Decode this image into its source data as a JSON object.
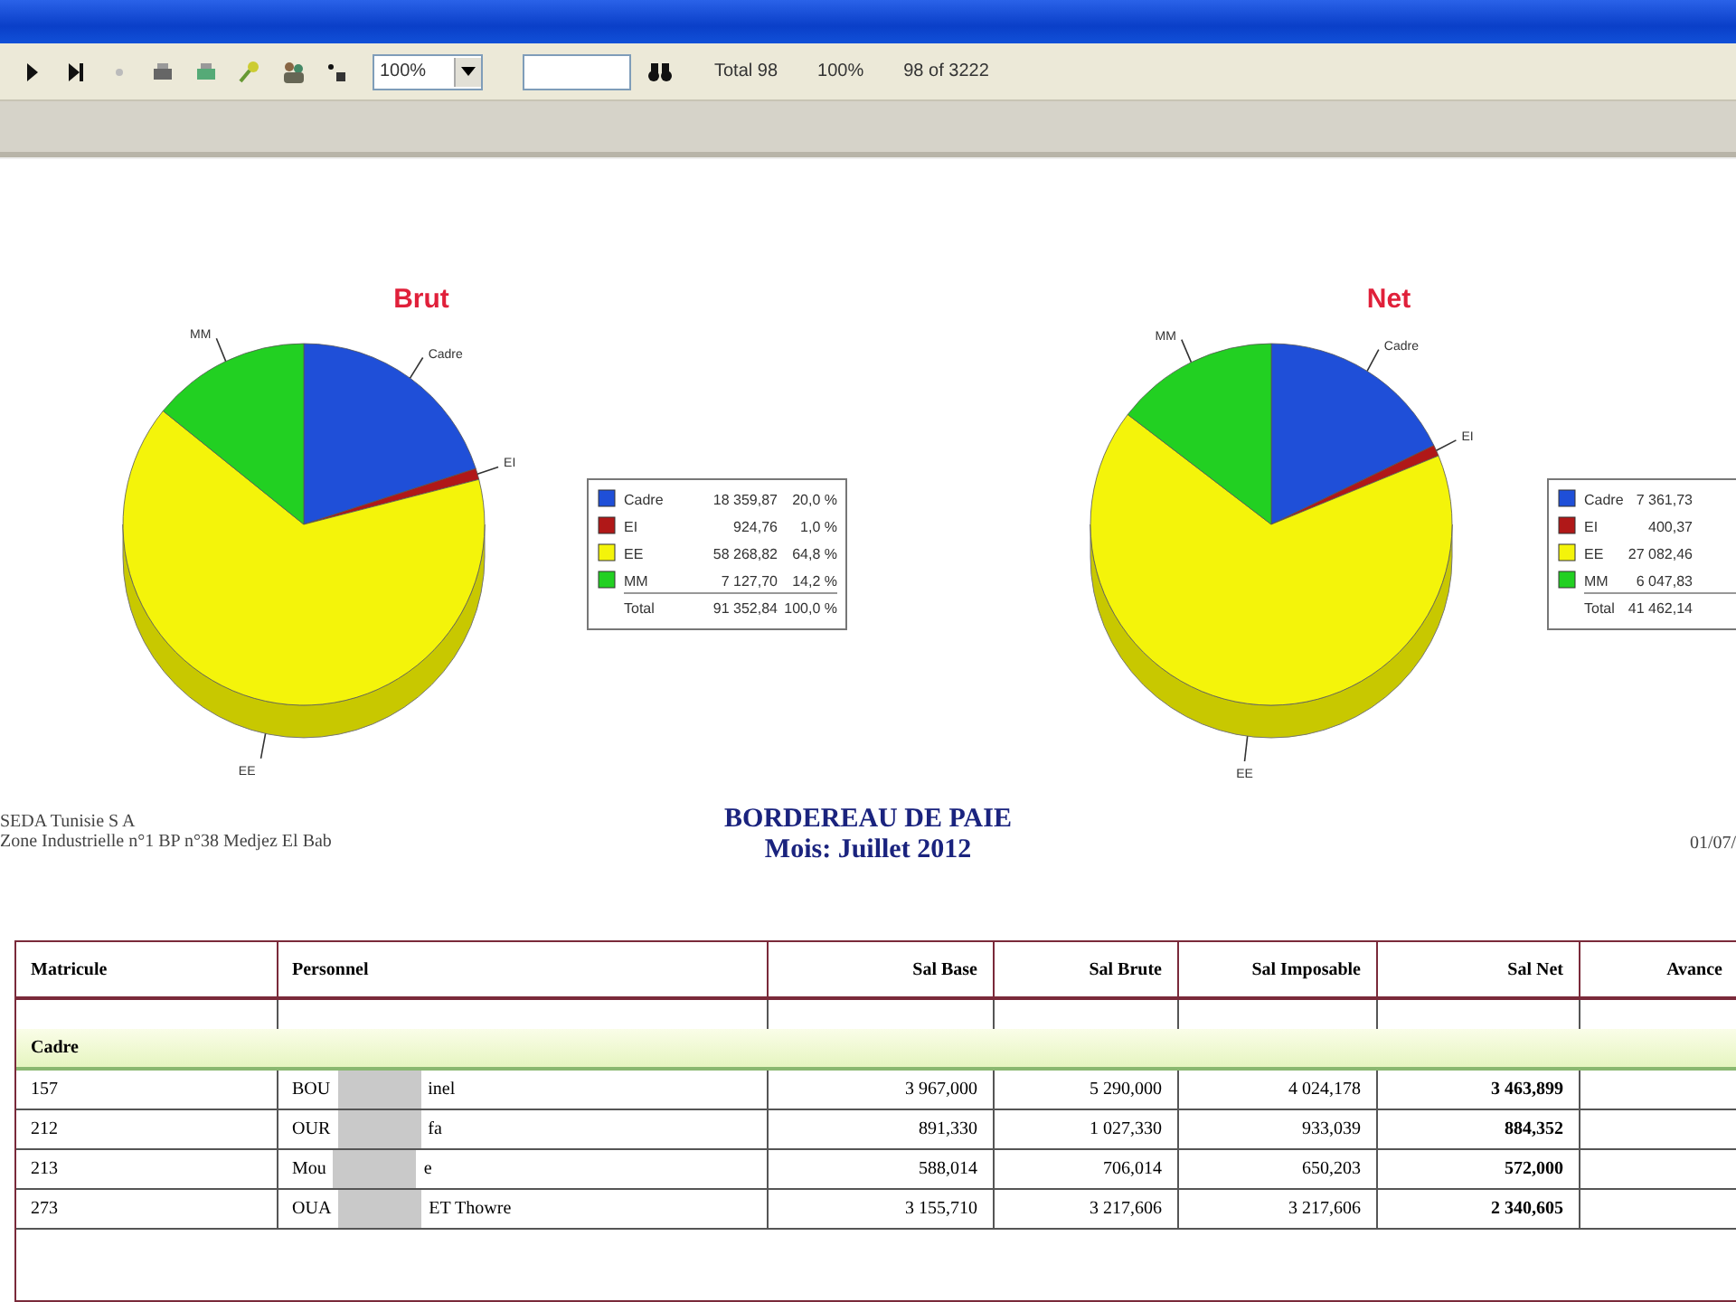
{
  "toolbar": {
    "zoom": "100%",
    "total": "Total 98",
    "percent": "100%",
    "pages": "98 of 3222"
  },
  "charts": [
    {
      "chart_data": {
        "type": "pie",
        "title": "Brut",
        "categories": [
          "Cadre",
          "EI",
          "EE",
          "MM"
        ],
        "series": [
          {
            "values": [
              20.0,
              1.0,
              64.8,
              14.2
            ]
          }
        ]
      },
      "legend": [
        {
          "name": "Cadre",
          "value": "18 359,87",
          "pct": "20,0 %",
          "color": "#1f4fd8"
        },
        {
          "name": "EI",
          "value": "924,76",
          "pct": "1,0 %",
          "color": "#b01818"
        },
        {
          "name": "EE",
          "value": "58 268,82",
          "pct": "64,8 %",
          "color": "#f4f40a"
        },
        {
          "name": "MM",
          "value": "7 127,70",
          "pct": "14,2 %",
          "color": "#22d022"
        },
        {
          "name": "Total",
          "value": "91 352,84",
          "pct": "100,0 %"
        }
      ]
    },
    {
      "chart_data": {
        "type": "pie",
        "title": "Net",
        "categories": [
          "Cadre",
          "EI",
          "EE",
          "MM"
        ],
        "series": [
          {
            "values": [
              17.8,
              1.0,
              66.6,
              14.6
            ]
          }
        ]
      },
      "legend": [
        {
          "name": "Cadre",
          "value": "7 361,73",
          "color": "#1f4fd8"
        },
        {
          "name": "EI",
          "value": "400,37",
          "color": "#b01818"
        },
        {
          "name": "EE",
          "value": "27 082,46",
          "color": "#f4f40a"
        },
        {
          "name": "MM",
          "value": "6 047,83",
          "color": "#22d022"
        },
        {
          "name": "Total",
          "value": "41 462,14"
        }
      ]
    }
  ],
  "company": [
    "SEDA Tunisie S A",
    "Zone Industrielle n°1 BP n°38 Medjez El Bab"
  ],
  "report_title": "BORDEREAU DE PAIE",
  "report_month": "Mois:  Juillet 2012",
  "report_date": "01/07/",
  "table": {
    "columns": [
      "Matricule",
      "Personnel",
      "Sal Base",
      "Sal Brute",
      "Sal Imposable",
      "Sal Net",
      "Avance"
    ],
    "group": "Cadre",
    "rows": [
      {
        "matricule": "157",
        "name_start": "BOU",
        "name_end": "inel",
        "base": "3 967,000",
        "brute": "5 290,000",
        "imposable": "4 024,178",
        "net": "3 463,899"
      },
      {
        "matricule": "212",
        "name_start": "OUR",
        "name_end": "fa",
        "base": "891,330",
        "brute": "1 027,330",
        "imposable": "933,039",
        "net": "884,352"
      },
      {
        "matricule": "213",
        "name_start": "Mou",
        "name_end": "e",
        "base": "588,014",
        "brute": "706,014",
        "imposable": "650,203",
        "net": "572,000"
      },
      {
        "matricule": "273",
        "name_start": "OUA",
        "name_end": "ET Thowre",
        "base": "3 155,710",
        "brute": "3 217,606",
        "imposable": "3 217,606",
        "net": "2 340,605"
      }
    ]
  }
}
